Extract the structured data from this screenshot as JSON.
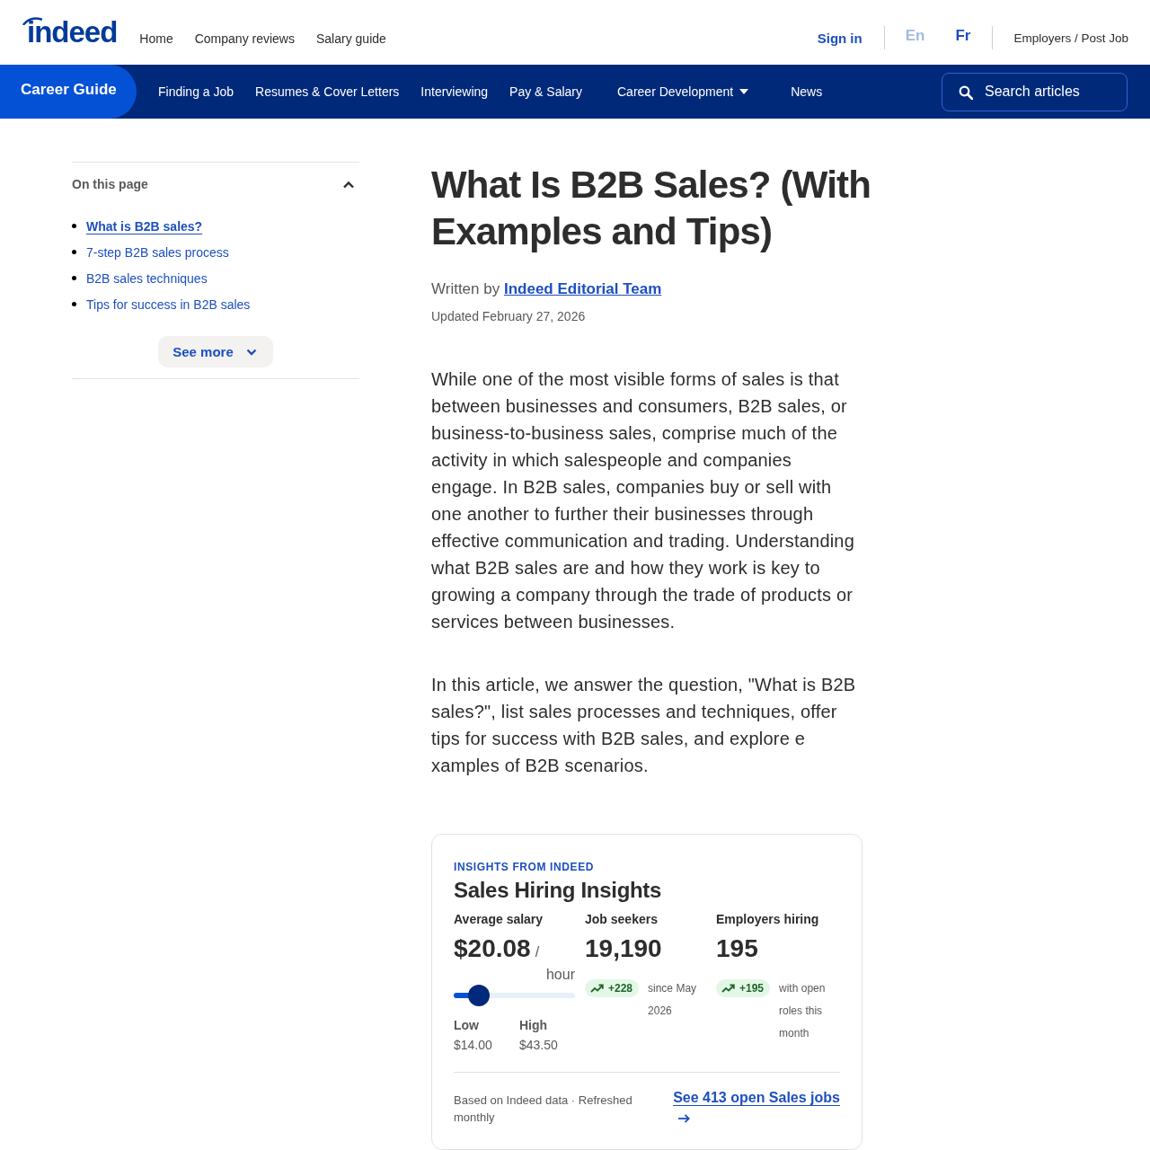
{
  "header": {
    "logo": "indeed",
    "nav": [
      "Home",
      "Company reviews",
      "Salary guide"
    ],
    "sign_in": "Sign in",
    "languages": [
      {
        "label": "En",
        "selected": true
      },
      {
        "label": "Fr",
        "selected": false
      }
    ],
    "employers_link": "Employers / Post Job"
  },
  "career_nav": {
    "title": "Career Guide",
    "items": [
      {
        "label": "Finding a Job",
        "has_menu": false
      },
      {
        "label": "Resumes & Cover Letters",
        "has_menu": false
      },
      {
        "label": "Interviewing",
        "has_menu": false
      },
      {
        "label": "Pay & Salary",
        "has_menu": false
      },
      {
        "label": "Career Development",
        "has_menu": true
      },
      {
        "label": "News",
        "has_menu": false
      }
    ],
    "search": {
      "placeholder": "Search articles"
    }
  },
  "toc": {
    "title": "On this page",
    "expanded": true,
    "items": [
      {
        "label": "What is B2B sales?",
        "selected": true
      },
      {
        "label": "7-step B2B sales process",
        "selected": false
      },
      {
        "label": "B2B sales techniques",
        "selected": false
      },
      {
        "label": "Tips for success in B2B sales",
        "selected": false
      }
    ],
    "see_more": "See more"
  },
  "article": {
    "title": "What Is B2B Sales? (With Examples and Tips)",
    "byline_prefix": "Written by",
    "author": "Indeed Editorial Team",
    "updated": "Updated February 27, 2026",
    "paragraphs": [
      "While one of the most visible forms of sales is that between businesses and consumers, B2B sales, or business-to-business sales, comprise much of the activity in which salespeople and companies engage. In B2B sales, companies buy or sell with one another to further their businesses through effective communication and trading. Understanding what B2B sales are and how they work is key to growing a company through the trade of products or services between businesses.",
      "In this article, we answer the question, \"What is B2B sales?\", list sales processes and techniques, offer tips for success with B2B sales, and explore e xamples of B2B scenarios."
    ]
  },
  "insights": {
    "eyebrow": "INSIGHTS FROM INDEED",
    "title": "Sales Hiring Insights",
    "salary": {
      "label": "Average salary",
      "value": "$20.08",
      "per": "/",
      "unit": "hour",
      "level": 0.21,
      "low_label": "Low",
      "low": "$14.00",
      "high_label": "High",
      "high": "$43.50"
    },
    "stats": [
      {
        "label": "Job seekers",
        "value": "19,190",
        "change": "+228",
        "note": "since May 2026"
      },
      {
        "label": "Employers hiring",
        "value": "195",
        "change": "+195",
        "note": "with open roles this month"
      }
    ],
    "source": "Based on Indeed data · Refreshed monthly",
    "jobs_link": "See 413 open Sales jobs"
  }
}
